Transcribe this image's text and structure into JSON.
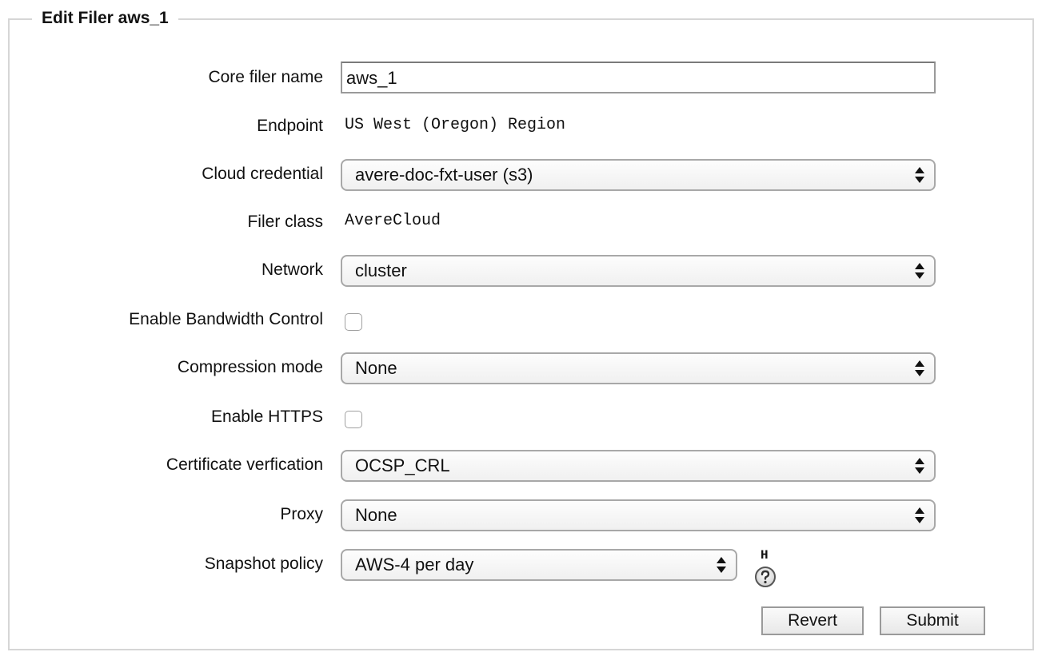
{
  "form": {
    "title": "Edit Filer aws_1",
    "fields": {
      "core_filer_name": {
        "label": "Core filer name",
        "value": "aws_1"
      },
      "endpoint": {
        "label": "Endpoint",
        "value": "US West (Oregon) Region"
      },
      "cloud_credential": {
        "label": "Cloud credential",
        "selected": "avere-doc-fxt-user (s3)"
      },
      "filer_class": {
        "label": "Filer class",
        "value": "AvereCloud"
      },
      "network": {
        "label": "Network",
        "selected": "cluster"
      },
      "bandwidth_control": {
        "label": "Enable Bandwidth Control",
        "checked": false
      },
      "compression_mode": {
        "label": "Compression mode",
        "selected": "None"
      },
      "https": {
        "label": "Enable HTTPS",
        "checked": false
      },
      "certificate_verification": {
        "label": "Certificate verfication",
        "selected": "OCSP_CRL"
      },
      "proxy": {
        "label": "Proxy",
        "selected": "None"
      },
      "snapshot_policy": {
        "label": "Snapshot policy",
        "selected": "AWS-4 per day"
      }
    },
    "help": {
      "letter": "H",
      "icon": "question-circle-icon"
    },
    "buttons": {
      "revert": "Revert",
      "submit": "Submit"
    }
  }
}
